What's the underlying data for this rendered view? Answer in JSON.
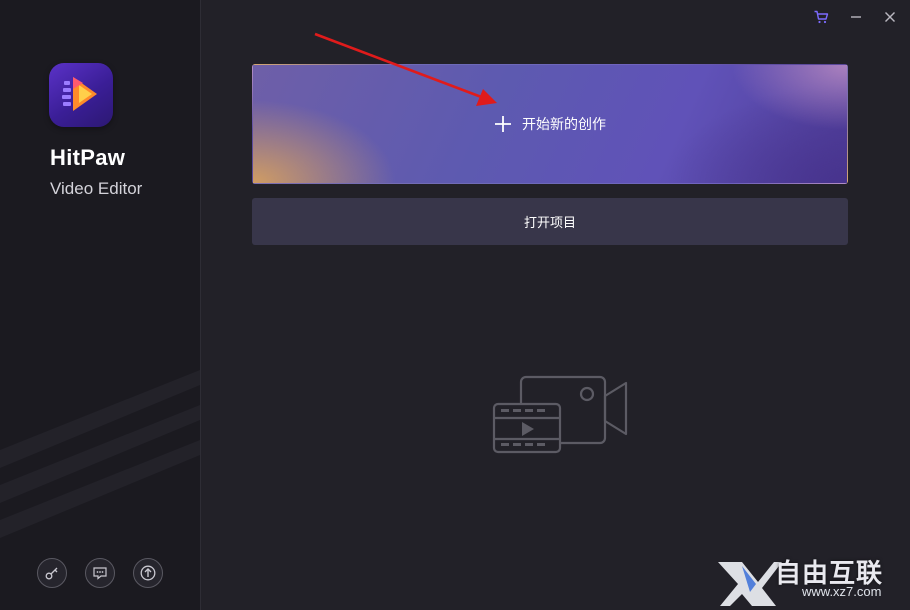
{
  "app": {
    "brand_title": "HitPaw",
    "brand_subtitle": "Video Editor"
  },
  "sidebar": {
    "bottom_buttons": [
      {
        "icon": "key-icon"
      },
      {
        "icon": "feedback-icon"
      },
      {
        "icon": "upgrade-icon"
      }
    ]
  },
  "titlebar": {
    "buttons": [
      {
        "icon": "cart-icon"
      },
      {
        "icon": "minimize-icon"
      },
      {
        "icon": "close-icon"
      }
    ]
  },
  "main": {
    "new_project_label": "开始新的创作",
    "open_project_label": "打开项目",
    "empty_state_icon": "video-clip-icon"
  },
  "watermark": {
    "brand_text": "自由互联",
    "url": "www.xz7.com"
  },
  "colors": {
    "background": "#222128",
    "sidebar": "#1b1a20",
    "open_button": "#38364a",
    "arrow": "#e01b1b",
    "cart": "#7c6bff"
  }
}
